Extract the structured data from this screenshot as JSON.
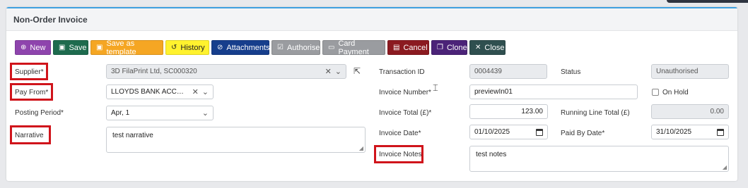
{
  "title": "Non-Order Invoice",
  "toolbar": {
    "new": "New",
    "save": "Save",
    "save_as_template": "Save as template",
    "history": "History",
    "attachments": "Attachments",
    "authorise": "Authorise",
    "card_payment": "Card Payment",
    "cancel": "Cancel",
    "clone": "Clone",
    "close": "Close"
  },
  "form": {
    "supplier_label": "Supplier*",
    "supplier_value": "3D FilaPrint Ltd, SC000320",
    "pay_from_label": "Pay From*",
    "pay_from_value": "LLOYDS BANK ACCOU...",
    "posting_period_label": "Posting Period*",
    "posting_period_value": "Apr, 1",
    "narrative_label": "Narrative",
    "narrative_value": "test narrative",
    "transaction_id_label": "Transaction ID",
    "transaction_id_value": "0004439",
    "invoice_number_label": "Invoice Number*",
    "invoice_number_value": "previewIn01",
    "invoice_total_label": "Invoice Total (£)*",
    "invoice_total_value": "123.00",
    "invoice_date_label": "Invoice Date*",
    "invoice_date_value": "01/10/2025",
    "invoice_notes_label": "Invoice Notes",
    "invoice_notes_value": "test notes",
    "status_label": "Status",
    "status_value": "Unauthorised",
    "on_hold_label": "On Hold",
    "running_line_total_label": "Running Line Total (£)",
    "running_line_total_value": "0.00",
    "paid_by_date_label": "Paid By Date*",
    "paid_by_date_value": "31/10/2025"
  },
  "icons": {
    "new": "plus-circle-icon",
    "save": "floppy-icon",
    "history": "history-icon",
    "attachments": "paperclip-icon",
    "authorise": "check-square-icon",
    "card_payment": "card-icon",
    "cancel": "trash-icon",
    "clone": "copy-icon",
    "close": "x-icon"
  },
  "colors": {
    "highlight": "#d0141b",
    "accent": "#3ea0e0"
  }
}
